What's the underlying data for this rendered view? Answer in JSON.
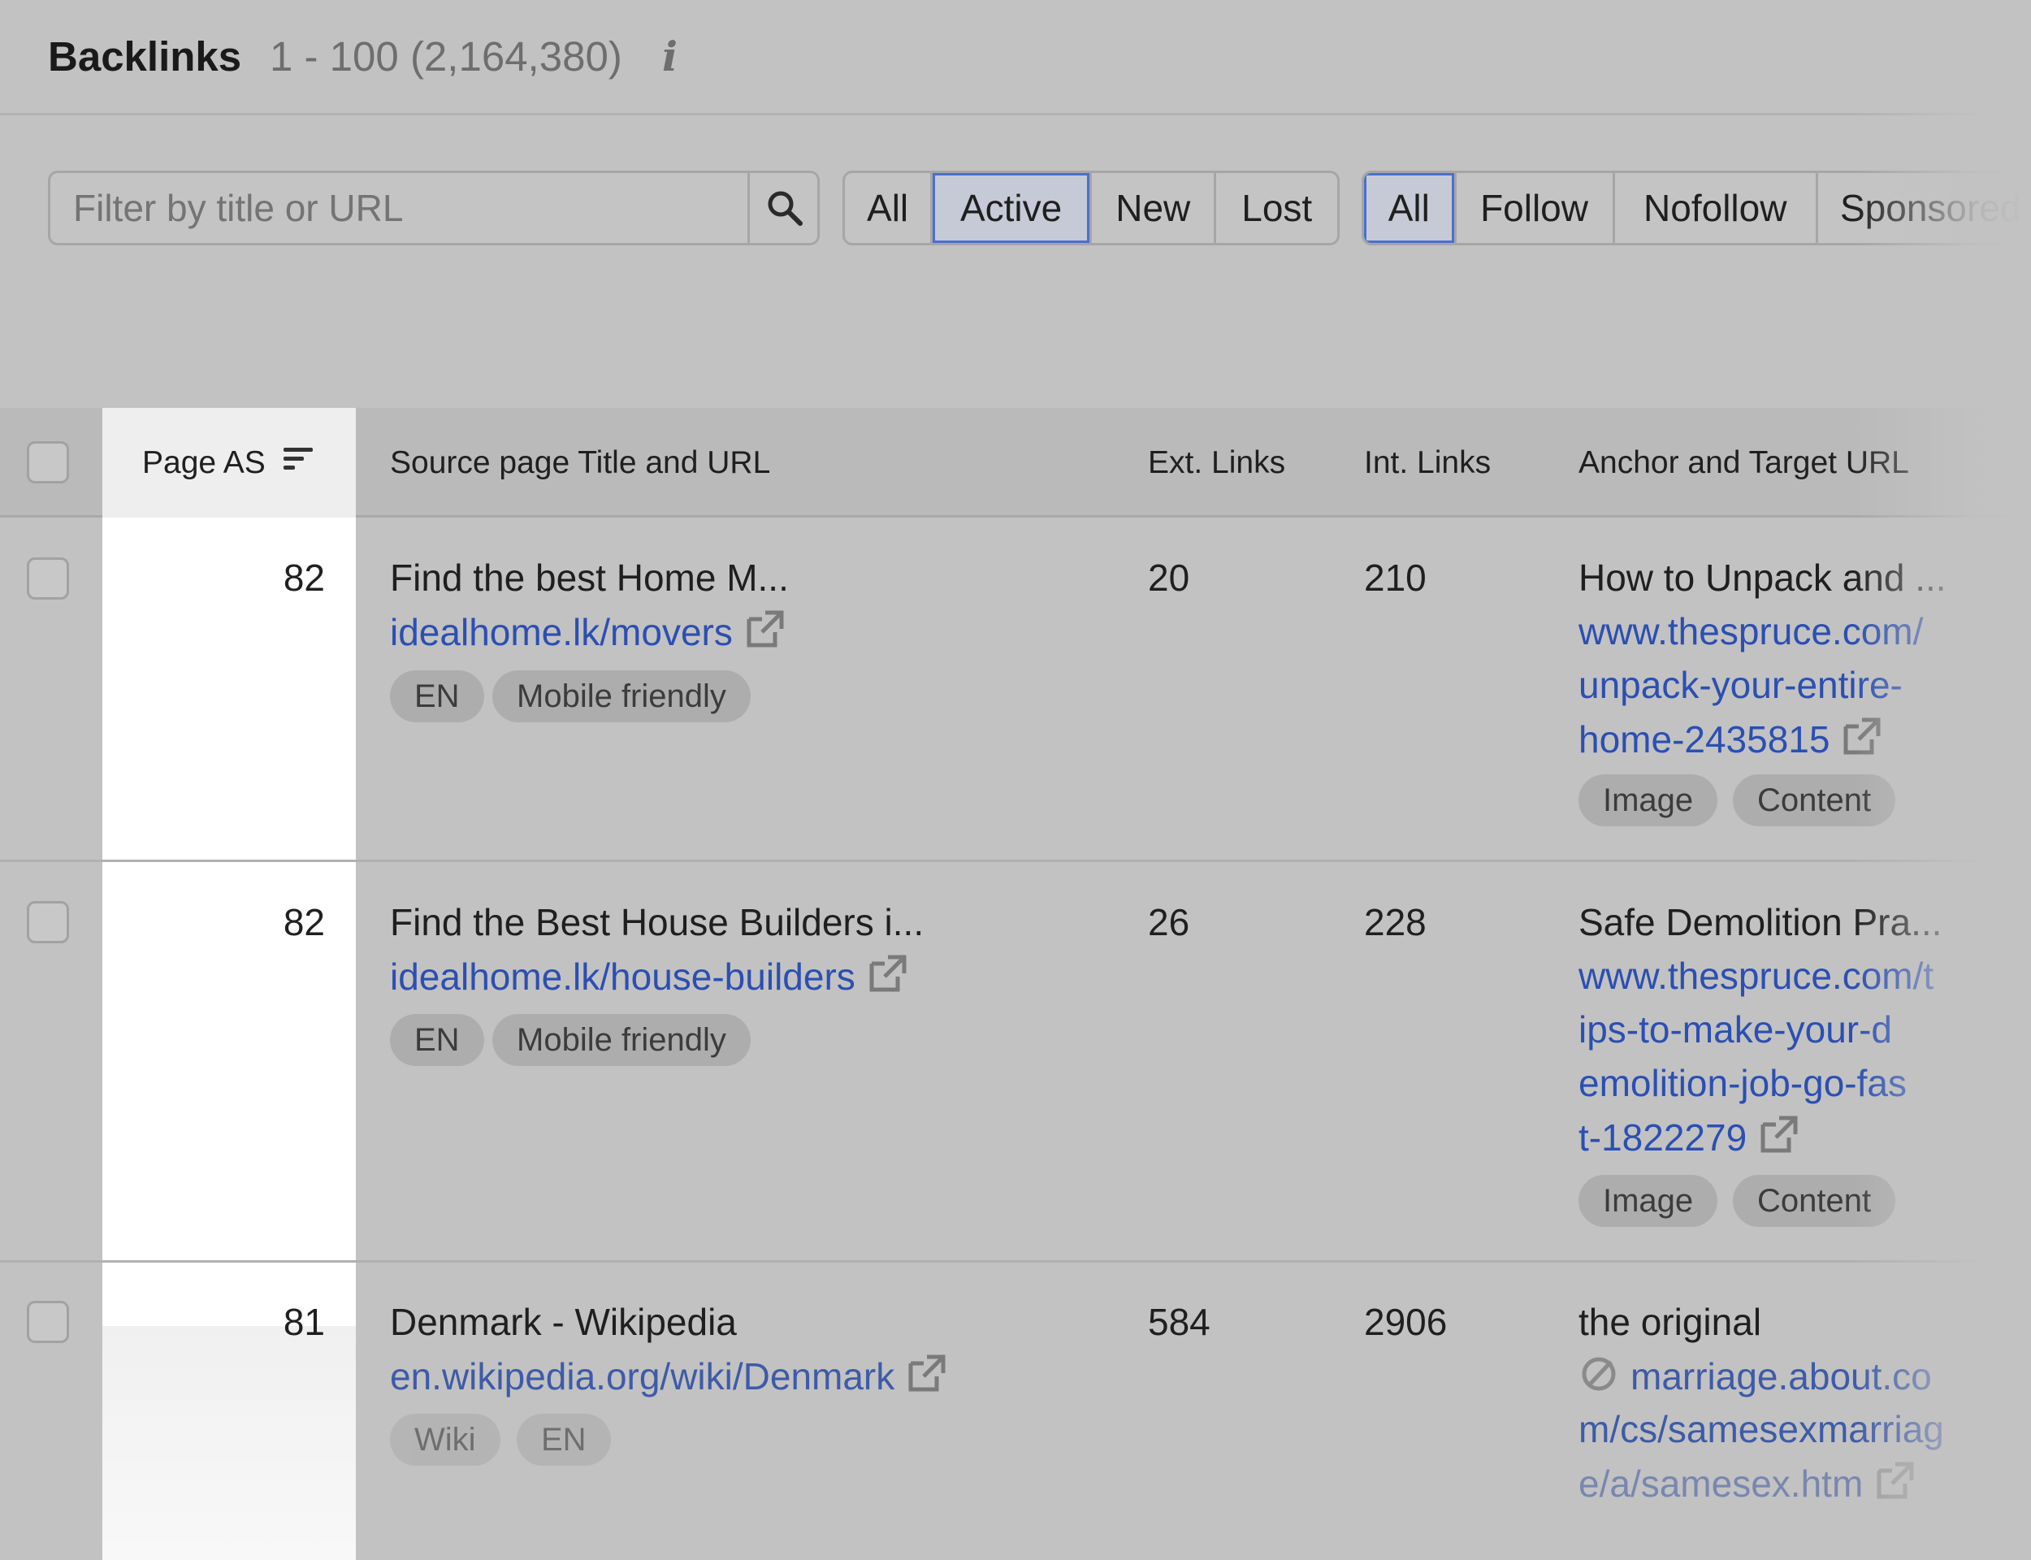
{
  "header": {
    "title": "Backlinks",
    "count": "1 - 100 (2,164,380)",
    "info_icon": "info-icon"
  },
  "filters": {
    "search_placeholder": "Filter by title or URL",
    "status_buttons": [
      {
        "label": "All"
      },
      {
        "label": "Active",
        "selected": true
      },
      {
        "label": "New"
      },
      {
        "label": "Lost"
      }
    ],
    "type_buttons": [
      {
        "label": "All",
        "selected": true
      },
      {
        "label": "Follow"
      },
      {
        "label": "Nofollow"
      },
      {
        "label": "Sponsored"
      }
    ]
  },
  "table": {
    "columns": [
      "Page AS",
      "Source page Title and URL",
      "Ext. Links",
      "Int. Links",
      "Anchor and Target URL"
    ],
    "sort_column": "Page AS",
    "rows": [
      {
        "page_as": "82",
        "title": "Find the best Home M...",
        "url": "idealhome.lk/movers",
        "tags": [
          "EN",
          "Mobile friendly"
        ],
        "ext_links": "20",
        "int_links": "210",
        "anchor": "How to Unpack and ...",
        "target_lines": [
          "www.thespruce.com/",
          "unpack-your-entire-",
          "home-2435815"
        ],
        "anchor_tags": [
          "Image",
          "Content"
        ]
      },
      {
        "page_as": "82",
        "title": "Find the Best House Builders i...",
        "url": "idealhome.lk/house-builders",
        "tags": [
          "EN",
          "Mobile friendly"
        ],
        "ext_links": "26",
        "int_links": "228",
        "anchor": "Safe Demolition Pra...",
        "target_lines": [
          "www.thespruce.com/t",
          "ips-to-make-your-d",
          "emolition-job-go-fas",
          "t-1822279"
        ],
        "anchor_tags": [
          "Image",
          "Content"
        ]
      },
      {
        "page_as": "81",
        "title": "Denmark - Wikipedia",
        "url": "en.wikipedia.org/wiki/Denmark",
        "tags": [
          "Wiki",
          "EN"
        ],
        "ext_links": "584",
        "int_links": "2906",
        "anchor": "the original",
        "target_lines": [
          "marriage.about.co",
          "m/cs/samesexmarriag",
          "e/a/samesex.htm"
        ],
        "anchor_tags": []
      }
    ]
  },
  "colors": {
    "link": "#2b4fb2",
    "selected_border": "#4b6fd1",
    "background": "#c2c2c2",
    "highlight_column": "#ffffff"
  }
}
